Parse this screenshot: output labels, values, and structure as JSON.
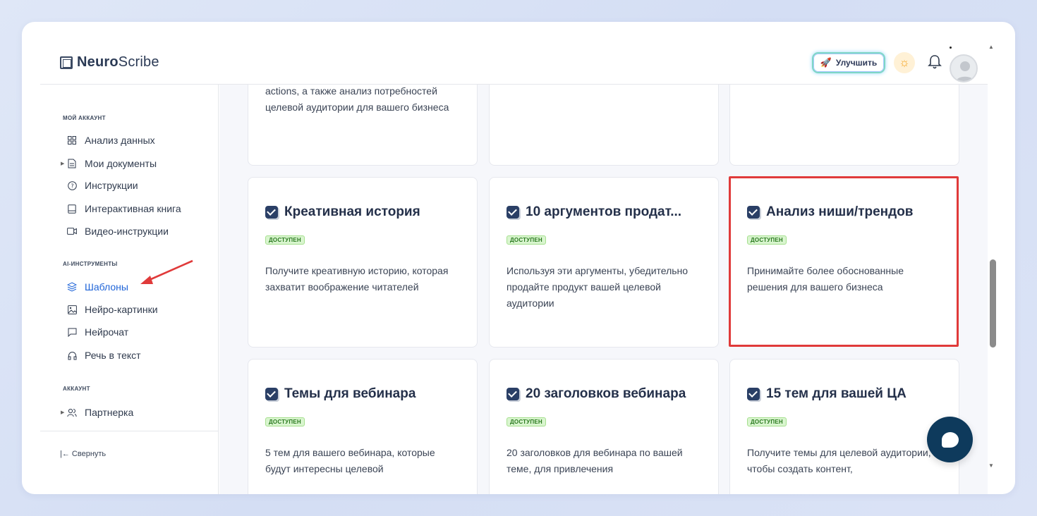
{
  "app": {
    "logo_bold": "Neuro",
    "logo_rest": "Scribe",
    "upgrade_label": "Улучшить"
  },
  "sidebar": {
    "sections": [
      {
        "title": "МОЙ АККАУНТ"
      },
      {
        "title": "AI-ИНСТРУМЕНТЫ"
      },
      {
        "title": "АККАУНТ"
      }
    ],
    "items": [
      {
        "label": "Анализ данных",
        "icon": "grid-icon"
      },
      {
        "label": "Мои документы",
        "icon": "document-icon"
      },
      {
        "label": "Инструкции",
        "icon": "help-circle-icon"
      },
      {
        "label": "Интерактивная книга",
        "icon": "book-icon"
      },
      {
        "label": "Видео-инструкции",
        "icon": "video-icon"
      },
      {
        "label": "Шаблоны",
        "icon": "layers-icon",
        "active": true
      },
      {
        "label": "Нейро-картинки",
        "icon": "image-icon"
      },
      {
        "label": "Нейрочат",
        "icon": "chat-icon"
      },
      {
        "label": "Речь в текст",
        "icon": "headphones-icon"
      },
      {
        "label": "Партнерка",
        "icon": "users-icon"
      }
    ],
    "collapse_label": "Свернуть",
    "collapse_icon": "|←"
  },
  "cards_top": [
    {
      "desc": "actions, а также анализ потребностей целевой аудитории для вашего бизнеса"
    },
    {
      "desc": ""
    },
    {
      "desc": ""
    }
  ],
  "cards": [
    {
      "title": "Креативная история",
      "badge": "ДОСТУПЕН",
      "desc": "Получите креативную историю, которая захватит воображение читателей"
    },
    {
      "title": "10 аргументов продат...",
      "badge": "ДОСТУПЕН",
      "desc": "Используя эти аргументы, убедительно продайте продукт вашей целевой аудитории"
    },
    {
      "title": "Анализ ниши/трендов",
      "badge": "ДОСТУПЕН",
      "desc": "Принимайте более обоснованные решения для вашего бизнеса",
      "highlighted": true
    },
    {
      "title": "Темы для вебинара",
      "badge": "ДОСТУПЕН",
      "desc": "5 тем для вашего вебинара, которые будут интересны целевой"
    },
    {
      "title": "20 заголовков вебинара",
      "badge": "ДОСТУПЕН",
      "desc": "20 заголовков для вебинара по вашей теме, для привлечения"
    },
    {
      "title": "15 тем для вашей ЦА",
      "badge": "ДОСТУПЕН",
      "desc": "Получите темы для целевой аудитории, чтобы создать контент,"
    }
  ],
  "colors": {
    "accent": "#1f64d8",
    "badge_bg": "#d9f5cf",
    "highlight": "#e03a3a",
    "chat_button": "#0e3a5c"
  }
}
